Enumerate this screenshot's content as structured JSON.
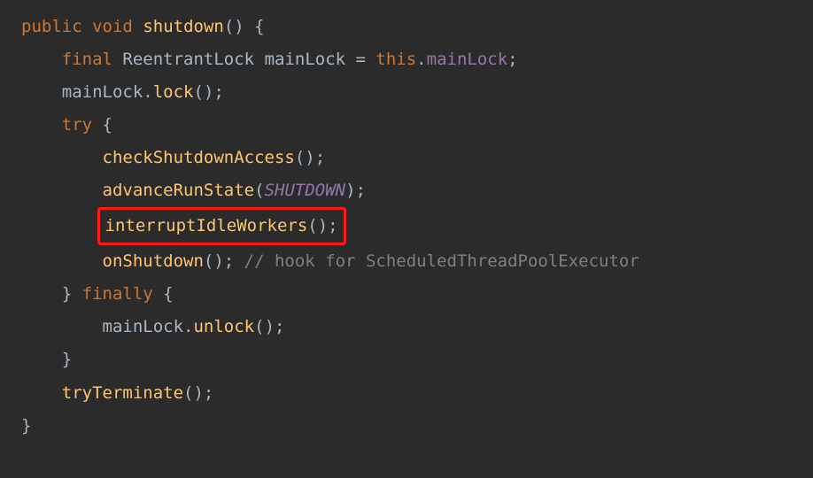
{
  "code": {
    "l1": {
      "kw1": "public",
      "kw2": "void",
      "method": "shutdown",
      "p1": "()",
      "p2": " {"
    },
    "l2": {
      "indent": "    ",
      "kw": "final",
      "type": " ReentrantLock ",
      "var": "mainLock",
      "op": " = ",
      "this": "this",
      "dot": ".",
      "field": "mainLock",
      "semi": ";"
    },
    "l3": {
      "indent": "    ",
      "obj": "mainLock",
      "dot": ".",
      "method": "lock",
      "p": "();"
    },
    "l4": {
      "indent": "    ",
      "kw": "try",
      "p": " {"
    },
    "l5": {
      "indent": "        ",
      "method": "checkShutdownAccess",
      "p": "();"
    },
    "l6": {
      "indent": "        ",
      "method": "advanceRunState",
      "p1": "(",
      "arg": "SHUTDOWN",
      "p2": ");"
    },
    "l7": {
      "indent": "        ",
      "method": "interruptIdleWorkers",
      "p": "();"
    },
    "l8": {
      "indent": "        ",
      "method": "onShutdown",
      "p": "(); ",
      "comment": "// hook for ScheduledThreadPoolExecutor"
    },
    "l9": {
      "indent": "    ",
      "p1": "} ",
      "kw": "finally",
      "p2": " {"
    },
    "l10": {
      "indent": "        ",
      "obj": "mainLock",
      "dot": ".",
      "method": "unlock",
      "p": "();"
    },
    "l11": {
      "indent": "    ",
      "p": "}"
    },
    "l12": {
      "indent": "    ",
      "method": "tryTerminate",
      "p": "();"
    },
    "l13": {
      "p": "}"
    }
  }
}
